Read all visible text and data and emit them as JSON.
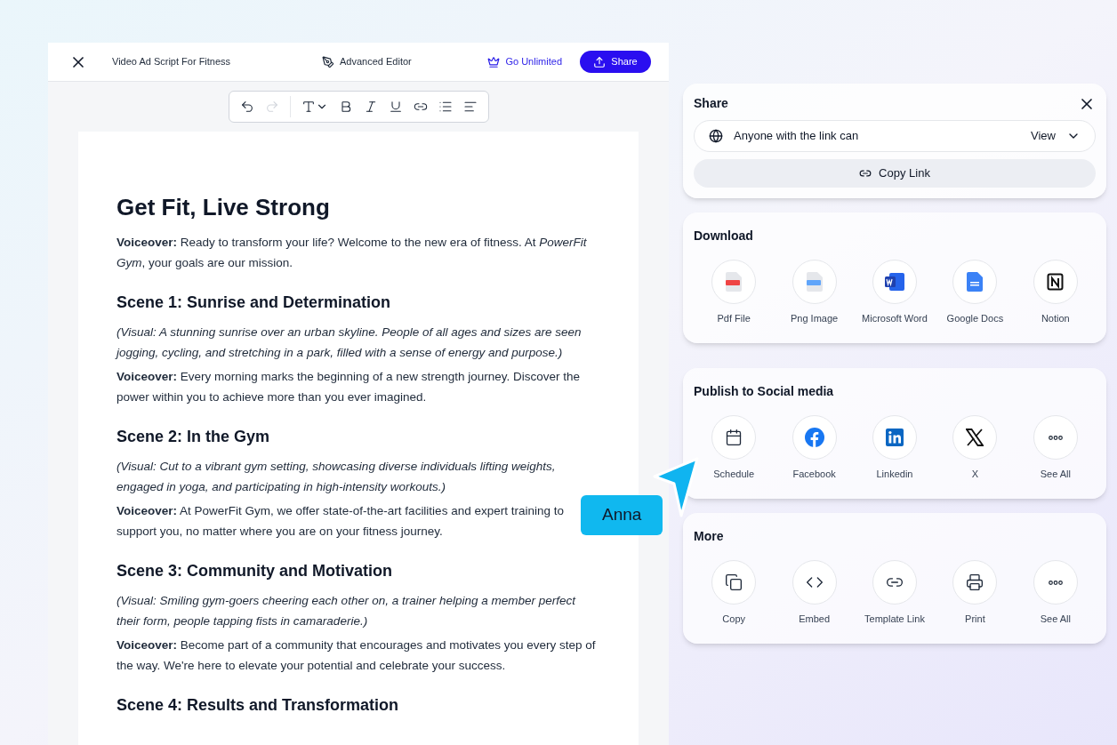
{
  "editor": {
    "title": "Video Ad Script For Fitness",
    "mode": "Advanced Editor",
    "upgrade": "Go Unlimited",
    "share_button": "Share"
  },
  "toolbar": [
    {
      "kind": "undo",
      "disabled": false
    },
    {
      "kind": "redo",
      "disabled": true
    },
    {
      "kind": "text",
      "disabled": false
    },
    {
      "kind": "bold",
      "disabled": false
    },
    {
      "kind": "italic",
      "disabled": false
    },
    {
      "kind": "underline",
      "disabled": false
    },
    {
      "kind": "link",
      "disabled": false
    },
    {
      "kind": "list",
      "disabled": false
    },
    {
      "kind": "align",
      "disabled": false
    }
  ],
  "document": [
    {
      "kind": "title",
      "text": "Get Fit, Live Strong"
    },
    {
      "kind": "para",
      "text": "**Voiceover:** Ready to transform your life? Welcome to the new era of fitness. At *PowerFit Gym*, your goals are our mission."
    },
    {
      "kind": "heading",
      "text": "Scene 1: Sunrise and Determination"
    },
    {
      "kind": "visual",
      "text": "(Visual: A stunning sunrise over an urban skyline. People of all ages and sizes are seen jogging, cycling, and stretching in a park, filled with a sense of energy and purpose.)"
    },
    {
      "kind": "para",
      "text": "**Voiceover:** Every morning marks the beginning of a new strength journey. Discover the power within you to achieve more than you ever imagined."
    },
    {
      "kind": "heading",
      "text": "Scene 2: In the Gym"
    },
    {
      "kind": "visual",
      "text": "(Visual: Cut to a vibrant gym setting, showcasing diverse individuals lifting weights, engaged in yoga, and participating in high-intensity workouts.)"
    },
    {
      "kind": "para",
      "text": "**Voiceover:** At PowerFit Gym, we offer state-of-the-art facilities and expert training to support you, no matter where you are on your fitness journey."
    },
    {
      "kind": "heading",
      "text": "Scene 3: Community and Motivation"
    },
    {
      "kind": "visual",
      "text": "(Visual: Smiling gym-goers cheering each other on, a trainer helping a member perfect their form, people tapping fists in camaraderie.)"
    },
    {
      "kind": "para",
      "text": "**Voiceover:** Become part of a community that encourages and motivates you every step of the way. We're here to elevate your potential and celebrate your success."
    },
    {
      "kind": "heading",
      "text": "Scene 4: Results and Transformation"
    }
  ],
  "cursor": {
    "name": "Anna"
  },
  "share": {
    "title": "Share",
    "access": "Anyone with the link can",
    "permission": "View",
    "copy_link": "Copy Link"
  },
  "sections": [
    {
      "title": "Download",
      "items": [
        {
          "kind": "pdf",
          "label": "Pdf File"
        },
        {
          "kind": "png",
          "label": "Png Image"
        },
        {
          "kind": "word",
          "label": "Microsoft Word"
        },
        {
          "kind": "docs",
          "label": "Google Docs"
        },
        {
          "kind": "notion",
          "label": "Notion"
        }
      ]
    },
    {
      "title": "Publish to Social media",
      "items": [
        {
          "kind": "calendar",
          "label": "Schedule"
        },
        {
          "kind": "facebook",
          "label": "Facebook"
        },
        {
          "kind": "linkedin",
          "label": "Linkedin"
        },
        {
          "kind": "x",
          "label": "X"
        },
        {
          "kind": "more",
          "label": "See All"
        }
      ]
    },
    {
      "title": "More",
      "items": [
        {
          "kind": "copy",
          "label": "Copy"
        },
        {
          "kind": "embed",
          "label": "Embed"
        },
        {
          "kind": "link",
          "label": "Template Link"
        },
        {
          "kind": "print",
          "label": "Print"
        },
        {
          "kind": "more",
          "label": "See All"
        }
      ]
    }
  ]
}
